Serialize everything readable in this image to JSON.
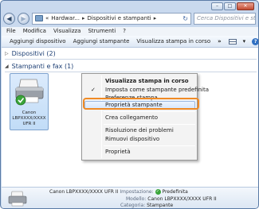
{
  "window": {
    "caption_buttons": [
      "–",
      "□",
      "✕"
    ]
  },
  "address_bar": {
    "prefix": "«",
    "crumb1": "Hardwar...",
    "crumb2": "Dispositivi e stampanti",
    "search_placeholder": "Cerca Dispositivi e stampanti"
  },
  "menubar": [
    "File",
    "Modifica",
    "Visualizza",
    "Strumenti",
    "?"
  ],
  "commandbar": {
    "items": [
      "Aggiungi dispositivo",
      "Aggiungi stampante",
      "Visualizza stampa in corso"
    ],
    "more": "»"
  },
  "groups": {
    "devices": "Dispositivi (2)",
    "printers": "Stampanti e fax (1)"
  },
  "printer": {
    "name": "Canon\nLBPXXXX/XXXX\nUFR II"
  },
  "context_menu": {
    "items": [
      {
        "label": "Visualizza stampa in corso"
      },
      {
        "label": "Imposta come stampante predefinita",
        "check": "✓"
      },
      {
        "label": "Preferenze stampa"
      },
      {
        "label": "Proprietà stampante"
      },
      {
        "label": "Crea collegamento"
      },
      {
        "label": "Risoluzione dei problemi"
      },
      {
        "label": "Rimuovi dispositivo"
      },
      {
        "label": "Proprietà"
      }
    ]
  },
  "details": {
    "title": "Canon LBPXXXX/XXXX UFR II",
    "state_label": "Impostazione:",
    "state_value": "Predefinita",
    "model_label": "Modello:",
    "model_value": "Canon LBPXXXX/XXXX UFR II",
    "category_label": "Categoria:",
    "category_value": "Stampante"
  }
}
